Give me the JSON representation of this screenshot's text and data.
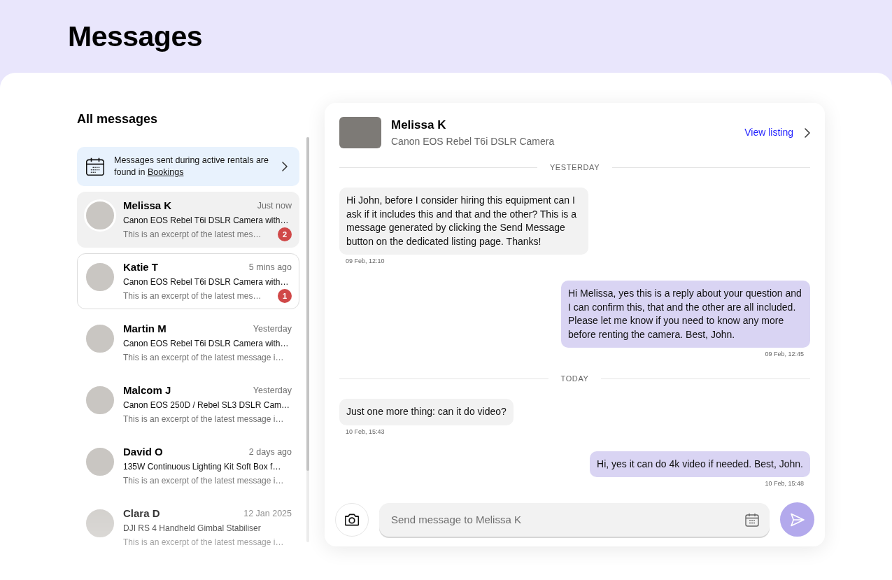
{
  "page": {
    "title": "Messages"
  },
  "sidebar": {
    "heading": "All messages",
    "notice": {
      "text": "Messages sent during active rentals are found in",
      "link": "Bookings"
    },
    "conversations": [
      {
        "name": "Melissa K",
        "time": "Just now",
        "listing": "Canon EOS Rebel T6i DSLR Camera with…",
        "excerpt": "This is an excerpt of the latest mes…",
        "unread": "2",
        "selected": true,
        "hovered": false
      },
      {
        "name": "Katie T",
        "time": "5 mins ago",
        "listing": "Canon EOS Rebel T6i DSLR Camera with…",
        "excerpt": "This is an excerpt of the latest mes…",
        "unread": "1",
        "selected": false,
        "hovered": true
      },
      {
        "name": "Martin M",
        "time": "Yesterday",
        "listing": "Canon EOS Rebel T6i DSLR Camera with…",
        "excerpt": "This is an excerpt of the latest message i…",
        "selected": false,
        "hovered": false
      },
      {
        "name": "Malcom J",
        "time": "Yesterday",
        "listing": "Canon EOS 250D / Rebel SL3 DSLR Cam…",
        "excerpt": "This is an excerpt of the latest message i…",
        "selected": false,
        "hovered": false
      },
      {
        "name": "David O",
        "time": "2 days ago",
        "listing": "135W Continuous Lighting Kit Soft Box f…",
        "excerpt": "This is an excerpt of the latest message i…",
        "selected": false,
        "hovered": false
      },
      {
        "name": "Clara D",
        "time": "12 Jan 2025",
        "listing": "DJI RS 4 Handheld Gimbal Stabiliser",
        "excerpt": "This is an excerpt of the latest message i…",
        "selected": false,
        "hovered": false
      }
    ]
  },
  "conversation": {
    "name": "Melissa K",
    "listing": "Canon EOS Rebel T6i DSLR Camera",
    "link": "View listing",
    "thread": [
      {
        "kind": "day",
        "label": "YESTERDAY"
      },
      {
        "kind": "received",
        "text": "Hi John, before I consider hiring this equipment can I ask if it includes this and that and the other? This is a message generated by clicking the Send Message button on the dedicated listing page. Thanks!",
        "time": "09 Feb, 12:10"
      },
      {
        "kind": "sent",
        "text": "Hi Melissa, yes this is a reply about your question and I can confirm this, that and the other are all included. Please let me know if you need to know any more before renting the camera. Best, John.",
        "time": "09 Feb, 12:45"
      },
      {
        "kind": "day",
        "label": "TODAY"
      },
      {
        "kind": "received",
        "text": "Just one more thing: can it do video?",
        "time": "10 Feb, 15:43"
      },
      {
        "kind": "sent",
        "text": "Hi, yes it can do 4k video if needed. Best, John.",
        "time": "10 Feb, 15:48"
      }
    ],
    "composer": {
      "placeholder": "Send message to Melissa K"
    }
  }
}
